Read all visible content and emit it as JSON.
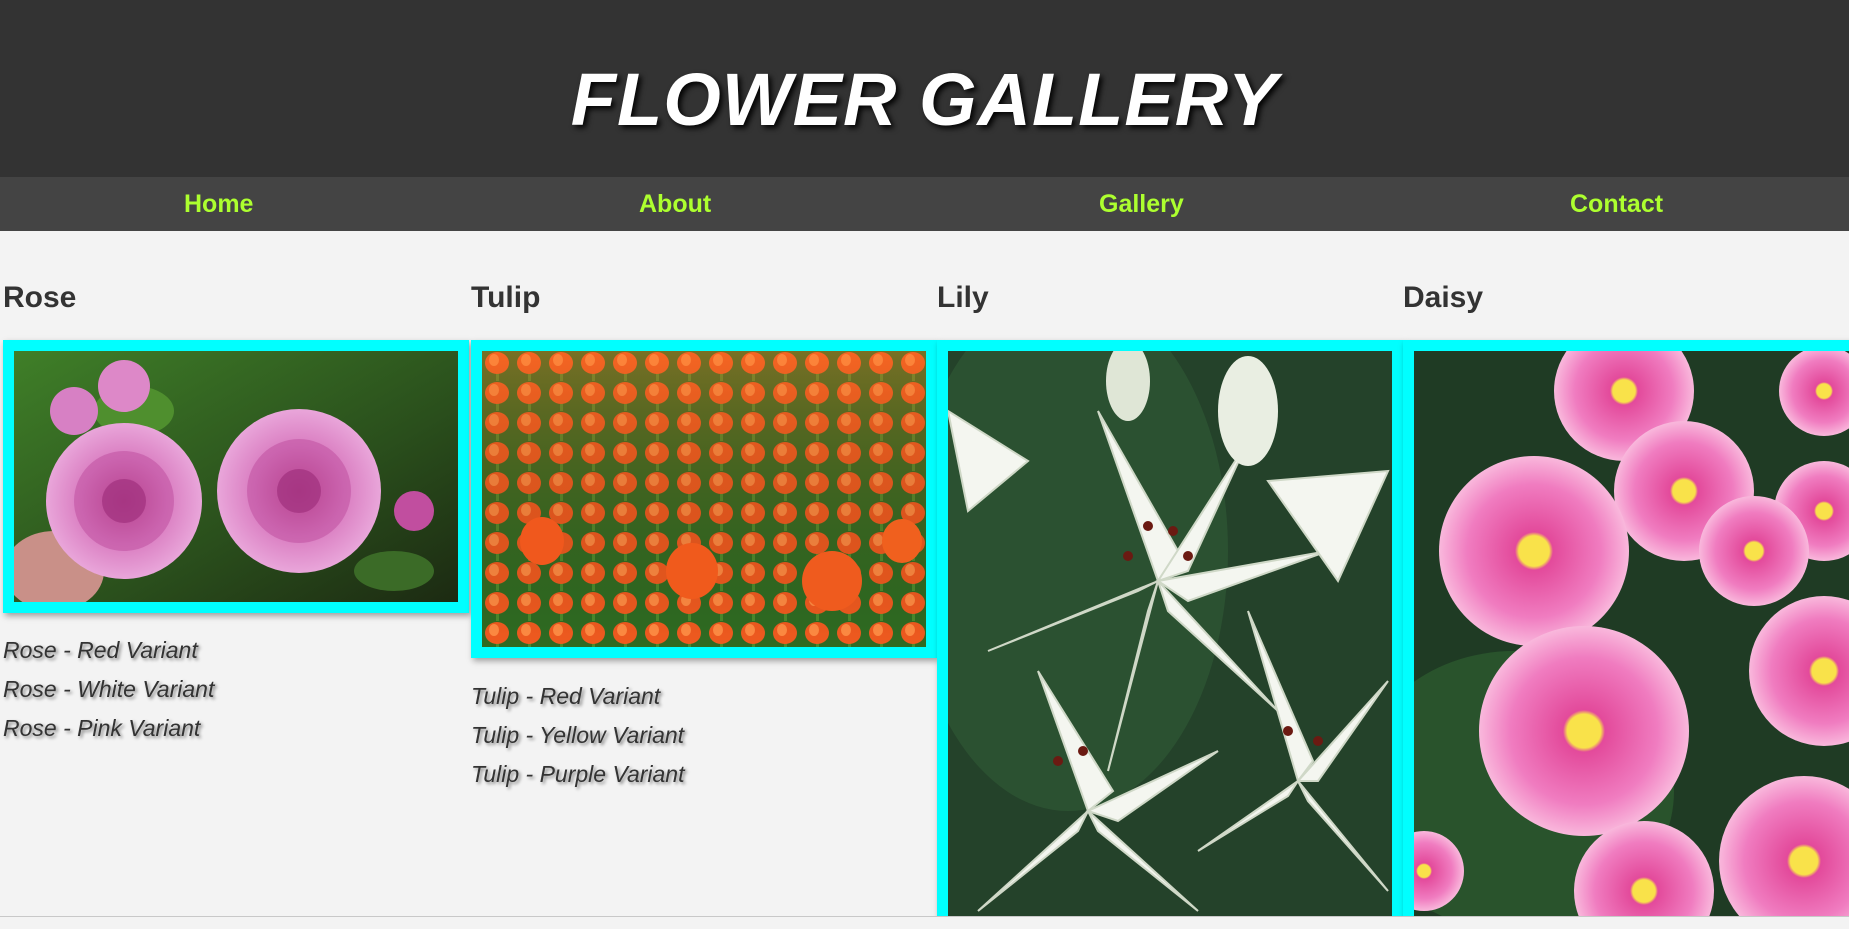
{
  "header": {
    "title": "FLOWER GALLERY"
  },
  "nav": {
    "items": [
      "Home",
      "About",
      "Gallery",
      "Contact"
    ]
  },
  "flowers": [
    {
      "name": "Rose",
      "image_icon": "rose-photo",
      "variants": [
        "Rose - Red Variant",
        "Rose - White Variant",
        "Rose - Pink Variant"
      ]
    },
    {
      "name": "Tulip",
      "image_icon": "tulip-photo",
      "variants": [
        "Tulip - Red Variant",
        "Tulip - Yellow Variant",
        "Tulip - Purple Variant"
      ]
    },
    {
      "name": "Lily",
      "image_icon": "lily-photo",
      "variants": []
    },
    {
      "name": "Daisy",
      "image_icon": "daisy-photo",
      "variants": []
    }
  ],
  "colors": {
    "header_bg": "#333333",
    "nav_bg": "#444444",
    "nav_link": "#adff2f",
    "frame_border": "#00ffff",
    "page_bg": "#f3f3f3"
  }
}
